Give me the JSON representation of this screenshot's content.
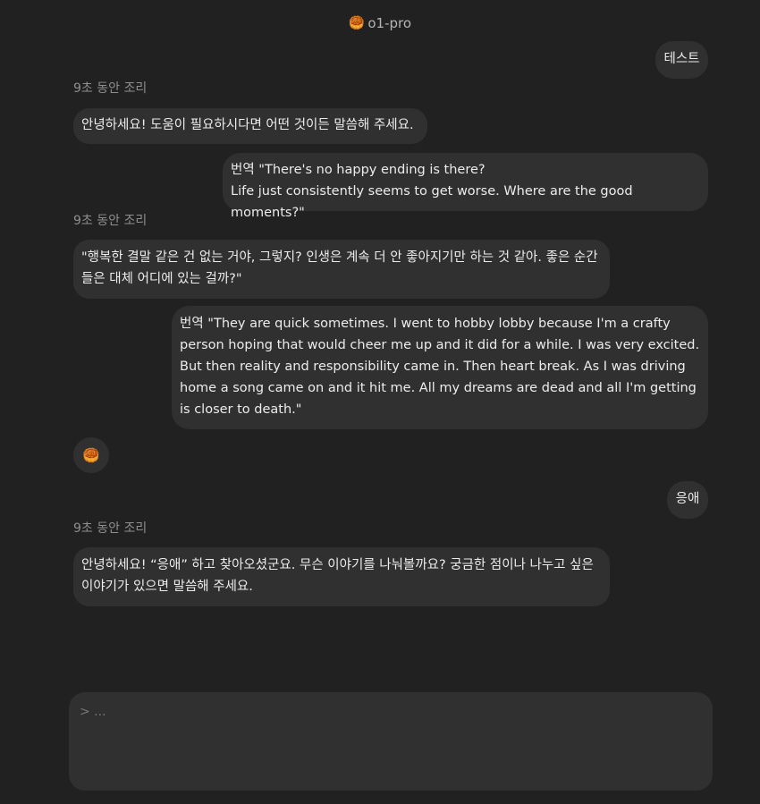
{
  "header": {
    "icon": "face-emoji",
    "model_name": "o1-pro"
  },
  "messages": {
    "user1": "테스트",
    "think1": "9초 동안 조리",
    "assistant1": "안녕하세요! 도움이 필요하시다면 어떤 것이든 말씀해 주세요.",
    "user2": "번역 \"There's no happy ending is there?\nLife just consistently seems to get worse. Where are the good moments?\"",
    "think2": "9초 동안 조리",
    "assistant2": "\"행복한 결말 같은 건 없는 거야, 그렇지? 인생은 계속 더 안 좋아지기만 하는 것 같아. 좋은 순간들은 대체 어디에 있는 걸까?\"",
    "user3": "번역 \"They are quick sometimes. I went to hobby lobby because I'm a crafty person hoping that would cheer me up and it did for a while. I was very excited. But then reality and responsibility came in. Then heart break. As I was driving home a song came on and it hit me. All my dreams are dead and all I'm getting is closer to death.\"",
    "reaction_icon": "face-emoji",
    "user4": "응애",
    "think3": "9초 동안 조리",
    "assistant3": "안녕하세요! “응애” 하고 찾아오셨군요. 무슨 이야기를 나눠볼까요? 궁금한 점이나 나누고 싶은 이야기가 있으면 말씀해 주세요."
  },
  "composer": {
    "placeholder": "> ..."
  }
}
